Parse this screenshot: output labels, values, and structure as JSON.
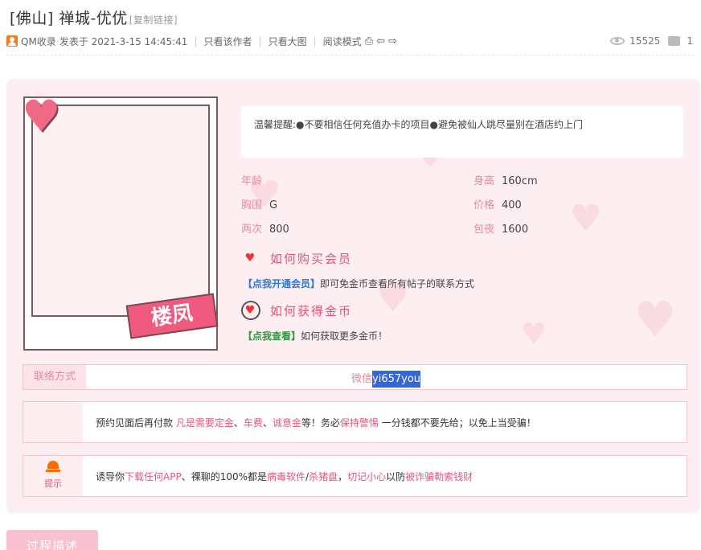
{
  "title": {
    "text": "[佛山] 禅城-优优",
    "copy_link": "[复制链接]"
  },
  "meta": {
    "author": "QM收录",
    "posted": "发表于 2021-3-15 14:45:41",
    "only_author": "只看该作者",
    "only_big_image": "只看大图",
    "reading_mode": "阅读模式",
    "icons": [
      "print-icon",
      "prev-icon",
      "next-icon"
    ]
  },
  "stats": {
    "views": "15525",
    "replies": "1"
  },
  "notice": "温馨提醒:●不要相信任何充值办卡的项目●避免被仙人跳尽量别在酒店约上门",
  "photo_tag": "楼凤",
  "info": [
    {
      "key": "年龄",
      "value": ""
    },
    {
      "key": "身高",
      "value": "160cm"
    },
    {
      "key": "胸围",
      "value": "G"
    },
    {
      "key": "价格",
      "value": "400"
    },
    {
      "key": "两次",
      "value": "800"
    },
    {
      "key": "包夜",
      "value": "1600"
    }
  ],
  "vip": {
    "heading": "如何购买会员",
    "link": "【点我开通会员】",
    "text": "即可免金币查看所有帖子的联系方式"
  },
  "coins": {
    "heading": "如何获得金币",
    "link": "【点我查看】",
    "text": "如何获取更多金币！"
  },
  "contact": {
    "label": "联络方式",
    "prefix": "微信",
    "value": "yi657you"
  },
  "note1": {
    "a": "预约见面后再付款 ",
    "b": "凡是需要定金",
    "c": "、",
    "d": "车费",
    "e": "、",
    "f": "诚意金",
    "g": "等！务必",
    "h": "保持警惕",
    "i": " 一分钱都不要先给；以免上当受骗！"
  },
  "note2": {
    "icon_label": "提示",
    "a": "诱导你",
    "b": "下载任何APP",
    "c": "、裸聊的100%都是",
    "d": "病毒软件",
    "e": "/",
    "f": "杀猪盘",
    "g": "，",
    "h": "切记小心",
    "i": "以防",
    "j": "被诈骗勒索钱财"
  },
  "bottom_tab": "过程描述",
  "colors": {
    "accent": "#e0577a",
    "card_bg": "#fdeef1",
    "highlight": "#3367d6"
  }
}
